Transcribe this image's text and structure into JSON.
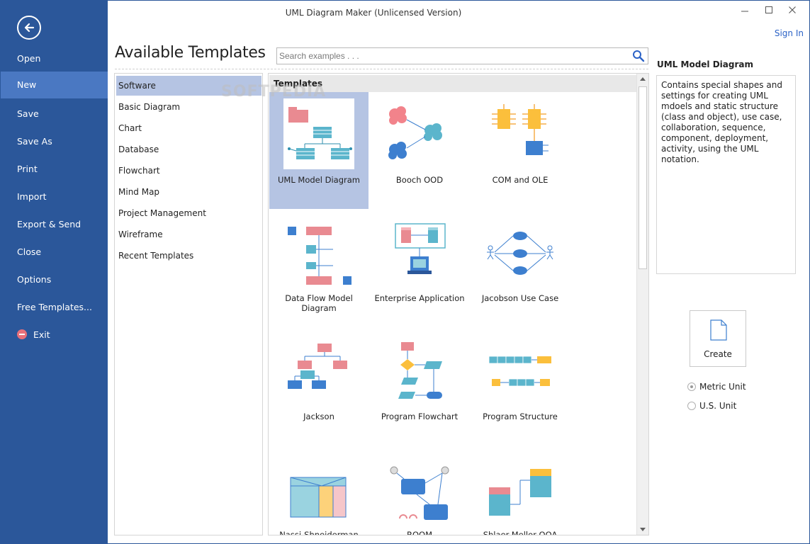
{
  "window": {
    "title": "UML Diagram Maker (Unlicensed Version)",
    "sign_in": "Sign In"
  },
  "nav": {
    "items": [
      {
        "label": "Open"
      },
      {
        "label": "New"
      },
      {
        "label": "Save"
      },
      {
        "label": "Save As"
      },
      {
        "label": "Print"
      },
      {
        "label": "Import"
      },
      {
        "label": "Export & Send"
      },
      {
        "label": "Close"
      },
      {
        "label": "Options"
      },
      {
        "label": "Free Templates..."
      },
      {
        "label": "Exit"
      }
    ]
  },
  "main": {
    "heading": "Available Templates",
    "search": {
      "placeholder": "Search examples . . ."
    },
    "categories": [
      {
        "label": "Software"
      },
      {
        "label": "Basic Diagram"
      },
      {
        "label": "Chart"
      },
      {
        "label": "Database"
      },
      {
        "label": "Flowchart"
      },
      {
        "label": "Mind Map"
      },
      {
        "label": "Project Management"
      },
      {
        "label": "Wireframe"
      },
      {
        "label": "Recent Templates"
      }
    ],
    "templates_header": "Templates",
    "watermark": "SOFTPEDIA",
    "templates": [
      {
        "label": "UML Model Diagram"
      },
      {
        "label": "Booch OOD"
      },
      {
        "label": "COM and OLE"
      },
      {
        "label": "Data Flow Model Diagram"
      },
      {
        "label": "Enterprise Application"
      },
      {
        "label": "Jacobson Use Case"
      },
      {
        "label": "Jackson"
      },
      {
        "label": "Program Flowchart"
      },
      {
        "label": "Program Structure"
      },
      {
        "label": "Nassi-Shneiderman"
      },
      {
        "label": "ROOM"
      },
      {
        "label": "Shlaer-Mellor OOA"
      }
    ]
  },
  "details": {
    "title": "UML Model Diagram",
    "description": "Contains special shapes and settings for creating UML mdoels and static structure (class and object), use case, collaboration, sequence, component, deployment, activity, using the UML notation.",
    "create_label": "Create",
    "units": [
      {
        "label": "Metric Unit",
        "selected": true
      },
      {
        "label": "U.S. Unit",
        "selected": false
      }
    ]
  },
  "colors": {
    "nav_bg": "#2b579a",
    "nav_active": "#4a78c2",
    "selection": "#b5c4e3"
  }
}
